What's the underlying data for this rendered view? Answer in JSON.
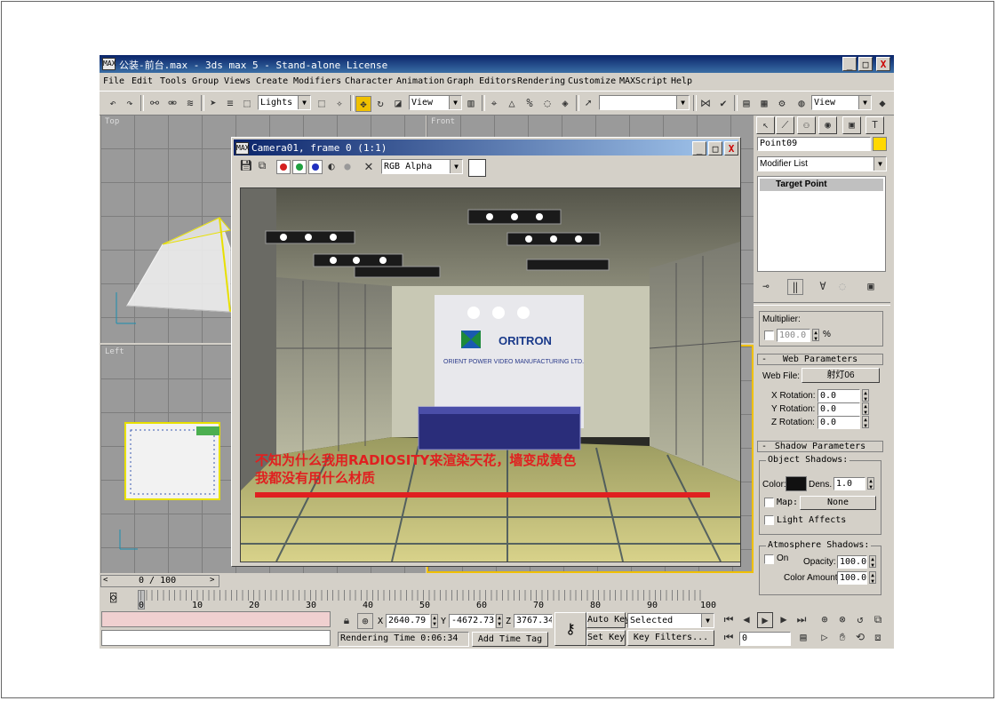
{
  "window": {
    "title": "公装-前台.max - 3ds max 5 - Stand-alone License",
    "icon_label": "MAX",
    "minimize": "_",
    "maximize": "□",
    "close": "X"
  },
  "menu": [
    "File",
    "Edit",
    "Tools",
    "Group",
    "Views",
    "Create",
    "Modifiers",
    "Character",
    "Animation",
    "Graph Editors",
    "Rendering",
    "Customize",
    "MAXScript",
    "Help"
  ],
  "toolbar": {
    "lights_select": "Lights",
    "view_select": "View",
    "selection_set": "",
    "view_select_right": "View",
    "icons": [
      "undo-icon",
      "redo-icon",
      "link-icon",
      "unlink-icon",
      "bind-space-warp-icon",
      "select-icon",
      "select-by-name-icon",
      "region-select-icon",
      "crossing-icon",
      "move-icon",
      "rotate-icon",
      "scale-icon",
      "pivot-icon",
      "mirror-icon",
      "align-icon",
      "normal-align-icon",
      "place-highlight-icon",
      "align-camera-icon",
      "render-icon"
    ]
  },
  "viewports": {
    "top": "Top",
    "front": "Front",
    "left": "Left"
  },
  "render_window": {
    "title": "Camera01, frame 0 (1:1)",
    "channel_select": "RGB Alpha",
    "logo_text": "ORITRON",
    "logo_subtext": "ORIENT POWER VIDEO MANUFACTURING LTD.",
    "overlay_line1": "不知为什么我用RADIOSITY来渲染天花，墙变成黄色",
    "overlay_line2": "我都没有用什么材质",
    "colors": {
      "red": "#d42020",
      "green": "#20a040",
      "blue": "#2030c0"
    }
  },
  "command_panel": {
    "object_name": "Point09",
    "name_color": "#ffd800",
    "modifier_list": "Modifier List",
    "stack_item": "Target Point",
    "multiplier_label": "Multiplier:",
    "multiplier_value": "100.0",
    "multiplier_unit": "%",
    "web_rollout": "Web Parameters",
    "web_file_label": "Web File:",
    "web_file_value": "射灯06",
    "x_rot_label": "X Rotation:",
    "x_rot": "0.0",
    "y_rot_label": "Y Rotation:",
    "y_rot": "0.0",
    "z_rot_label": "Z Rotation:",
    "z_rot": "0.0",
    "shadow_rollout": "Shadow Parameters",
    "object_shadows": "Object Shadows:",
    "color_label": "Color:",
    "dens_label": "Dens.",
    "dens_value": "1.0",
    "map_label": "Map:",
    "map_value": "None",
    "light_affects": "Light Affects",
    "atmos_shadows": "Atmosphere Shadows:",
    "on_label": "On",
    "opacity_label": "Opacity:",
    "opacity_value": "100.0",
    "color_amount_label": "Color Amount:",
    "color_amount_value": "100.0"
  },
  "timeline": {
    "frame_counter": "0 / 100",
    "ticks": [
      "0",
      "10",
      "20",
      "30",
      "40",
      "50",
      "60",
      "70",
      "80",
      "90",
      "100"
    ]
  },
  "status": {
    "x_label": "X",
    "x_value": "2640.79",
    "y_label": "Y",
    "y_value": "-4672.73",
    "z_label": "Z",
    "z_value": "3767.34",
    "rendering_time": "Rendering Time  0:06:34",
    "add_time_tag": "Add Time Tag",
    "auto_key": "Auto Key",
    "set_key": "Set Key",
    "key_mode": "Selected",
    "key_filters": "Key Filters...",
    "frame_field": "0"
  }
}
